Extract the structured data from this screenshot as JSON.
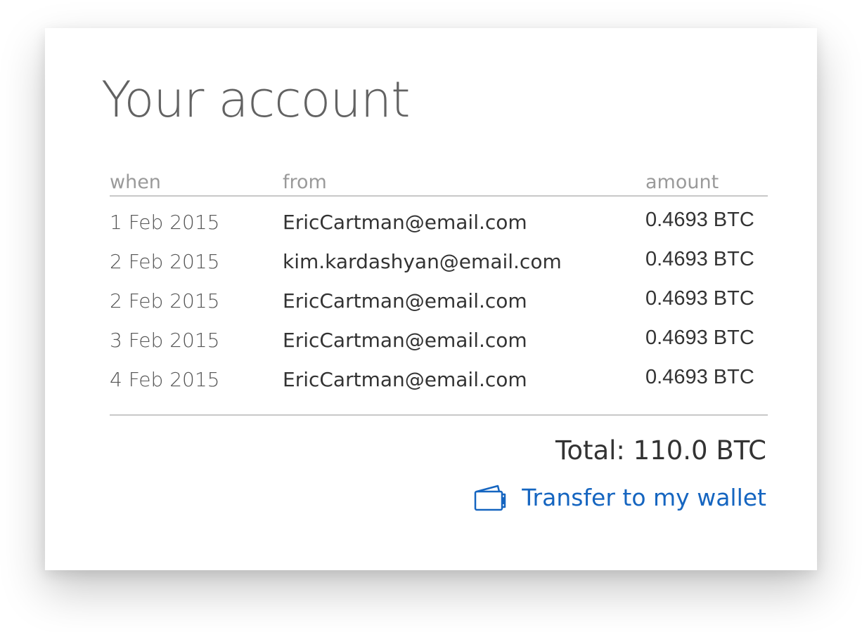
{
  "page": {
    "title": "Your account"
  },
  "table": {
    "headers": {
      "when": "when",
      "from": "from",
      "amount": "amount"
    },
    "rows": [
      {
        "when": "1 Feb 2015",
        "from": "EricCartman@email.com",
        "amount": "0.4693 BTC"
      },
      {
        "when": "2 Feb 2015",
        "from": "kim.kardashyan@email.com",
        "amount": "0.4693 BTC"
      },
      {
        "when": "2 Feb 2015",
        "from": "EricCartman@email.com",
        "amount": "0.4693 BTC"
      },
      {
        "when": "3 Feb 2015",
        "from": "EricCartman@email.com",
        "amount": "0.4693 BTC"
      },
      {
        "when": "4 Feb 2015",
        "from": "EricCartman@email.com",
        "amount": "0.4693 BTC"
      }
    ]
  },
  "summary": {
    "total": "Total: 110.0 BTC"
  },
  "actions": {
    "transfer_label": "Transfer to my wallet",
    "transfer_icon": "wallet-icon",
    "link_color": "#1565c0"
  }
}
